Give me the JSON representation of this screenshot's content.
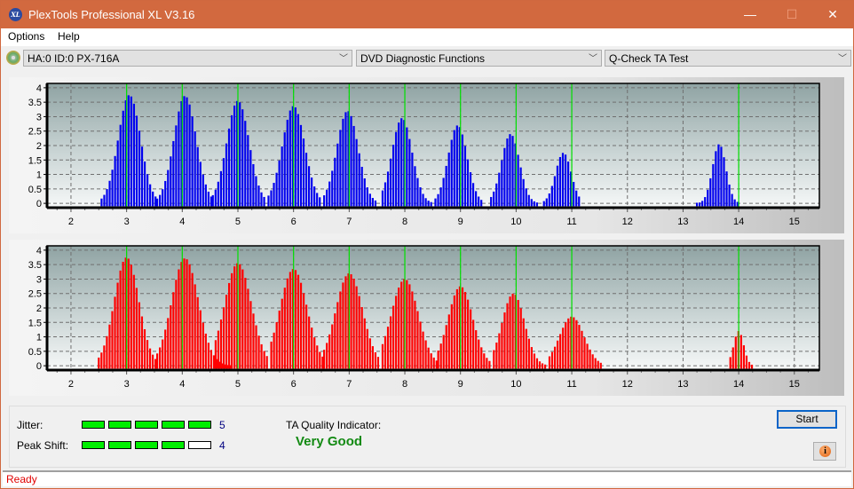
{
  "window": {
    "title": "PlexTools Professional XL V3.16",
    "icon_label": "XL",
    "controls": {
      "minimize": "—",
      "maximize": "☐",
      "close": "✕"
    }
  },
  "menu": [
    {
      "label": "Options"
    },
    {
      "label": "Help"
    }
  ],
  "toolbar": {
    "drive_select": "HA:0 ID:0  PX-716A",
    "function_select": "DVD Diagnostic Functions",
    "test_select": "Q-Check TA Test"
  },
  "results": {
    "jitter_label": "Jitter:",
    "jitter_value": "5",
    "jitter_level": 5,
    "peak_shift_label": "Peak Shift:",
    "peak_shift_value": "4",
    "peak_shift_level": 4,
    "level_max": 5,
    "ta_quality_label": "TA Quality Indicator:",
    "ta_quality_value": "Very Good",
    "start_button": "Start",
    "info_button": "i"
  },
  "status": {
    "text": "Ready"
  },
  "colors": {
    "title_bar": "#d2693f",
    "land_bars": "#0000ee",
    "pit_bars": "#ff0000",
    "marker_lines": "#00e000",
    "level_fill": "#00ee00",
    "quality_text": "#138a13",
    "status_text": "#e00000"
  },
  "chart_data": [
    {
      "type": "bar",
      "name": "top-chart",
      "title": "",
      "series_color": "#0000ee",
      "xlim": [
        1.57,
        15.45
      ],
      "ylim": [
        -0.15,
        4.15
      ],
      "xticks": [
        2,
        3,
        4,
        5,
        6,
        7,
        8,
        9,
        10,
        11,
        12,
        13,
        14,
        15
      ],
      "yticks": [
        0,
        0.5,
        1,
        1.5,
        2,
        2.5,
        3,
        3.5,
        4
      ],
      "ytick_labels": [
        "0",
        "0.5",
        "1",
        "1.5",
        "2",
        "2.5",
        "3",
        "3.5",
        "4"
      ],
      "markers": [
        3,
        4,
        5,
        6,
        7,
        8,
        9,
        10,
        11,
        14
      ],
      "grid": true,
      "clusters": [
        {
          "peak_x": 3.05,
          "peak_y": 3.75,
          "sigma": 0.2,
          "from": 2.55,
          "to": 3.55
        },
        {
          "peak_x": 4.05,
          "peak_y": 3.72,
          "sigma": 0.2,
          "from": 3.55,
          "to": 4.55
        },
        {
          "peak_x": 5.0,
          "peak_y": 3.55,
          "sigma": 0.2,
          "from": 4.55,
          "to": 5.5
        },
        {
          "peak_x": 6.0,
          "peak_y": 3.37,
          "sigma": 0.2,
          "from": 5.55,
          "to": 6.5
        },
        {
          "peak_x": 6.97,
          "peak_y": 3.2,
          "sigma": 0.19,
          "from": 6.55,
          "to": 7.5
        },
        {
          "peak_x": 7.95,
          "peak_y": 2.95,
          "sigma": 0.18,
          "from": 7.6,
          "to": 8.5
        },
        {
          "peak_x": 8.95,
          "peak_y": 2.7,
          "sigma": 0.17,
          "from": 8.55,
          "to": 9.4
        },
        {
          "peak_x": 9.9,
          "peak_y": 2.4,
          "sigma": 0.16,
          "from": 9.55,
          "to": 10.4
        },
        {
          "peak_x": 10.85,
          "peak_y": 1.75,
          "sigma": 0.14,
          "from": 10.5,
          "to": 11.15
        },
        {
          "peak_x": 13.65,
          "peak_y": 2.05,
          "sigma": 0.12,
          "from": 13.25,
          "to": 13.98
        }
      ]
    },
    {
      "type": "bar",
      "name": "bottom-chart",
      "title": "",
      "series_color": "#ff0000",
      "xlim": [
        1.57,
        15.45
      ],
      "ylim": [
        -0.15,
        4.15
      ],
      "xticks": [
        2,
        3,
        4,
        5,
        6,
        7,
        8,
        9,
        10,
        11,
        12,
        13,
        14,
        15
      ],
      "yticks": [
        0,
        0.5,
        1,
        1.5,
        2,
        2.5,
        3,
        3.5,
        4
      ],
      "ytick_labels": [
        "0",
        "0.5",
        "1",
        "1.5",
        "2",
        "2.5",
        "3",
        "3.5",
        "4"
      ],
      "markers": [
        3,
        4,
        5,
        6,
        7,
        8,
        9,
        10,
        11,
        14
      ],
      "grid": true,
      "clusters": [
        {
          "peak_x": 3.0,
          "peak_y": 3.75,
          "sigma": 0.22,
          "from": 2.5,
          "to": 3.55
        },
        {
          "peak_x": 4.05,
          "peak_y": 3.72,
          "sigma": 0.24,
          "from": 3.55,
          "to": 4.9
        },
        {
          "peak_x": 5.0,
          "peak_y": 3.55,
          "sigma": 0.24,
          "from": 4.6,
          "to": 5.55
        },
        {
          "peak_x": 6.0,
          "peak_y": 3.35,
          "sigma": 0.24,
          "from": 5.6,
          "to": 6.55
        },
        {
          "peak_x": 7.0,
          "peak_y": 3.2,
          "sigma": 0.24,
          "from": 6.55,
          "to": 7.55
        },
        {
          "peak_x": 8.0,
          "peak_y": 3.0,
          "sigma": 0.24,
          "from": 7.6,
          "to": 8.6
        },
        {
          "peak_x": 9.0,
          "peak_y": 2.75,
          "sigma": 0.22,
          "from": 8.6,
          "to": 9.55
        },
        {
          "peak_x": 9.95,
          "peak_y": 2.5,
          "sigma": 0.2,
          "from": 9.6,
          "to": 10.55
        },
        {
          "peak_x": 11.0,
          "peak_y": 1.7,
          "sigma": 0.22,
          "from": 10.6,
          "to": 11.55
        },
        {
          "peak_x": 14.0,
          "peak_y": 1.2,
          "sigma": 0.09,
          "from": 13.85,
          "to": 14.25
        }
      ]
    }
  ]
}
